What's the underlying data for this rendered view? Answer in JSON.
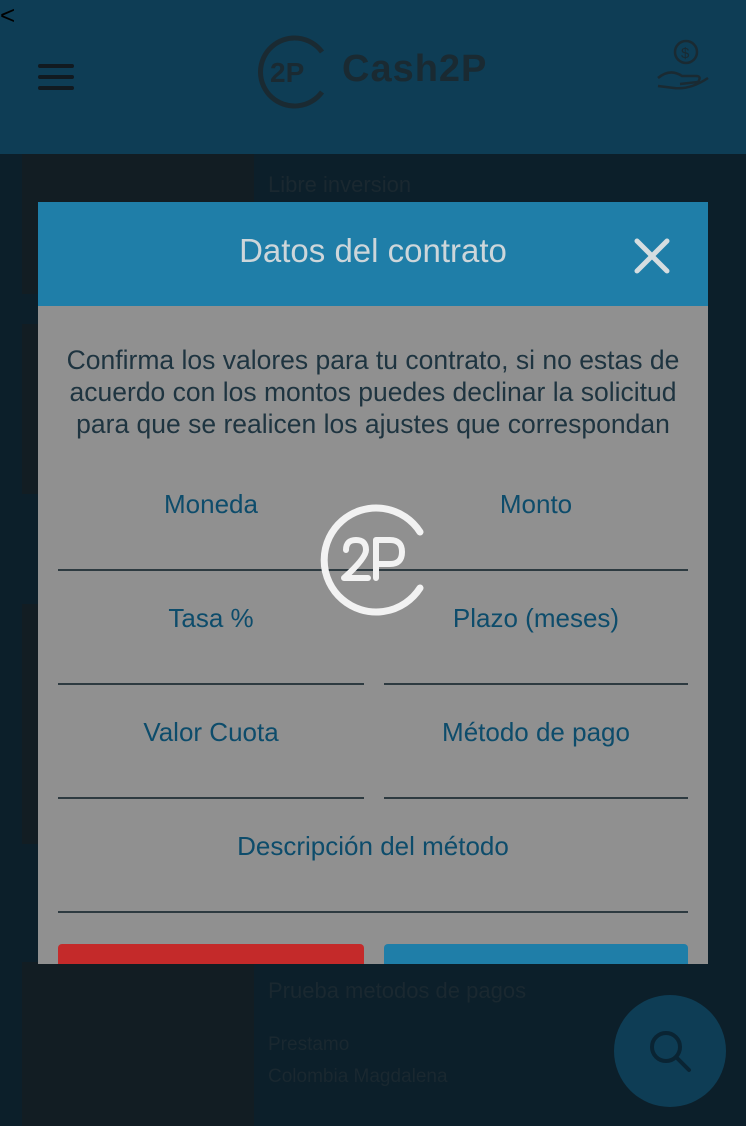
{
  "nav": {
    "back": "<"
  },
  "header": {
    "brand": "Cash2P"
  },
  "background_list": [
    {
      "title": "Libre inversion",
      "sub1": "",
      "sub2": ""
    },
    {
      "title": "Prueba metodos de pagos",
      "sub1": "Prestamo",
      "sub2": "Colombia Magdalena"
    }
  ],
  "modal": {
    "title": "Datos del contrato",
    "intro": "Confirma los valores para tu contrato, si no estas de acuerdo con los montos puedes declinar la solicitud para que se realicen los ajustes que correspondan",
    "fields": {
      "moneda": "Moneda",
      "monto": "Monto",
      "tasa": "Tasa %",
      "plazo": "Plazo (meses)",
      "cuota": "Valor Cuota",
      "metodo": "Método de pago",
      "descripcion": "Descripción del método"
    }
  },
  "colors": {
    "header_bg": "#0e3d55",
    "modal_header": "#1f7ea8",
    "decline": "#c42a2a",
    "accept": "#1f7ea8"
  },
  "icons": [
    "menu-icon",
    "logo-icon",
    "hand-money-icon",
    "close-icon",
    "search-icon",
    "loader-logo-icon"
  ]
}
